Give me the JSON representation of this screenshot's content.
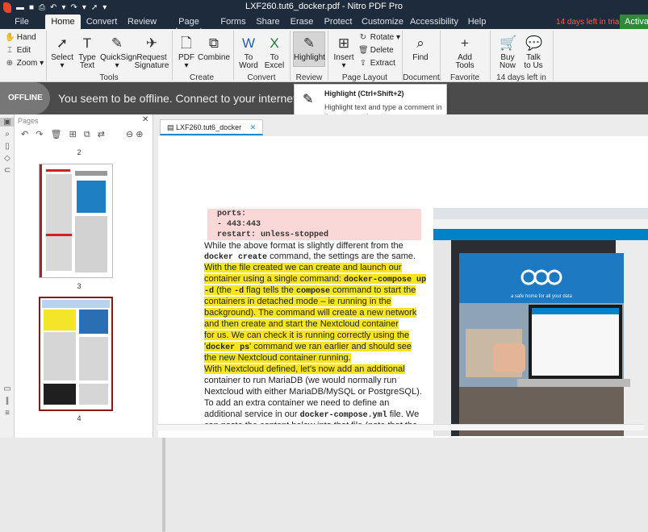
{
  "window": {
    "title": "LXF260.tut6_docker.pdf - Nitro PDF Pro",
    "trial_text": "14 days left in trial",
    "activate_label": "Activa"
  },
  "menu": {
    "tabs": [
      {
        "label": "File"
      },
      {
        "label": "Home"
      },
      {
        "label": "Convert"
      },
      {
        "label": "Review"
      },
      {
        "label": "Page Layout"
      },
      {
        "label": "Forms"
      },
      {
        "label": "Share"
      },
      {
        "label": "Erase"
      },
      {
        "label": "Protect"
      },
      {
        "label": "Customize"
      },
      {
        "label": "Accessibility"
      },
      {
        "label": "Help"
      }
    ]
  },
  "ribbon": {
    "small": {
      "hand": "Hand",
      "edit": "Edit",
      "zoom": "Zoom"
    },
    "tools": {
      "select": "Select",
      "type_text_1": "Type",
      "type_text_2": "Text",
      "quicksign": "QuickSign",
      "request_1": "Request",
      "request_2": "Signature",
      "group": "Tools"
    },
    "create": {
      "pdf": "PDF",
      "combine": "Combine",
      "group": "Create"
    },
    "convert": {
      "to1": "To",
      "word": "Word",
      "to2": "To",
      "excel": "Excel",
      "group": "Convert"
    },
    "review": {
      "highlight": "Highlight",
      "group": "Review"
    },
    "page_layout": {
      "insert": "Insert",
      "rotate": "Rotate",
      "delete": "Delete",
      "extract": "Extract",
      "group": "Page Layout"
    },
    "document": {
      "find": "Find",
      "group": "Document"
    },
    "favorite": {
      "add_1": "Add",
      "add_2": "Tools",
      "group": "Favorite Tools"
    },
    "trial": {
      "buy_1": "Buy",
      "buy_2": "Now",
      "talk_1": "Talk",
      "talk_2": "to Us",
      "group": "14 days left in trial"
    }
  },
  "offline": {
    "badge": "OFFLINE",
    "message": "You seem to be offline. Connect to your internet to get t"
  },
  "tooltip": {
    "title": "Highlight (Ctrl+Shift+2)",
    "description": "Highlight text and type a comment in its pop-up note."
  },
  "pages_panel": {
    "header": "Pages",
    "page_numbers": [
      "2",
      "3",
      "4"
    ]
  },
  "document": {
    "tab_label": "LXF260.tut6_docker",
    "code_lines": [
      "ports:",
      "  - 443:443",
      "  restart: unless-stopped"
    ],
    "p1_a": "While the above format is slightly different from the",
    "p1_b_code": "docker create",
    "p1_b_rest": " command, the settings are the same.",
    "h1": "    With the file created we can create and launch our",
    "h2_a": "container using a single command: ",
    "h2_code": "docker-compose up",
    "h3_code1": "-d",
    "h3_a": " (the ",
    "h3_code2": "-d",
    "h3_b": " flag tells the ",
    "h3_code3": "compose",
    "h3_c": " command to start the",
    "h4": "containers in detached mode – ie running in the",
    "h5": "background). The command will create a new network",
    "h6": "and then create and start the Nextcloud container",
    "h7": "for us. We can check it is running correctly using the",
    "h8_a": "'",
    "h8_code": "docker ps",
    "h8_b": "' command we ran earlier and should see",
    "h9": "the new Nextcloud container running.",
    "h10": "    With Nextcloud defined, let's now add an additional",
    "p2_1": "container to run MariaDB (we would normally run",
    "p2_2": "Nextcloud with either MariaDB/MySQL or PostgreSQL).",
    "p2_3": "To add an extra container we need to define an",
    "p2_4_a": "additional service in our ",
    "p2_4_code": "docker-compose.yml",
    "p2_4_b": " file. We",
    "p2_5": "can paste the content below into that file (note that the",
    "photo_tagline": "a safe home for all your data"
  }
}
